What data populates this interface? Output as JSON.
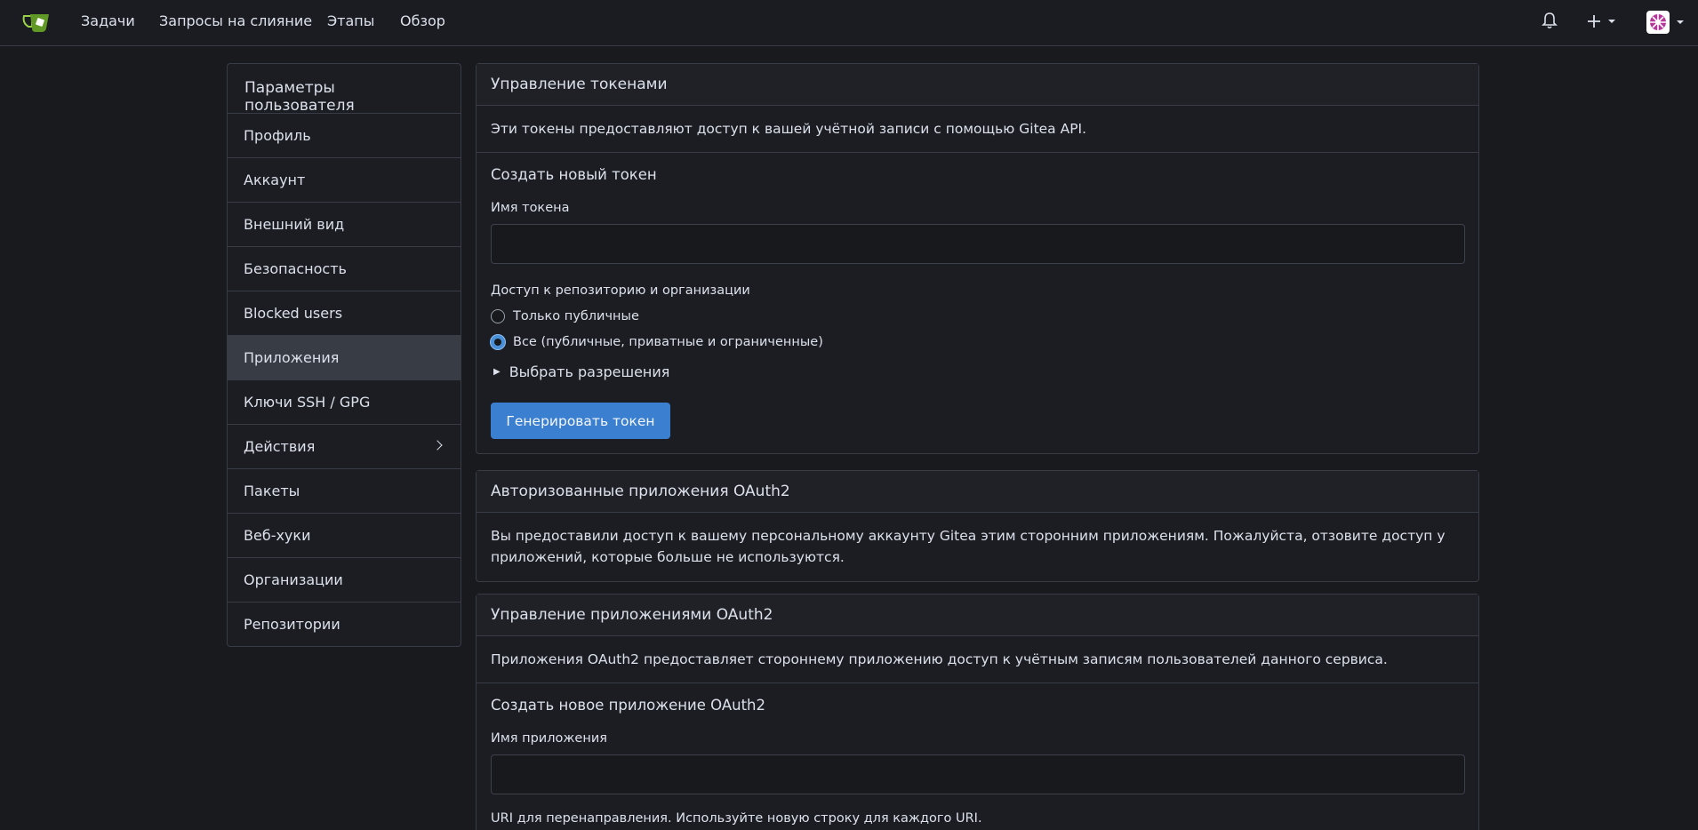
{
  "nav": {
    "logo_icon": "gitea-logo-icon",
    "links": [
      "Задачи",
      "Запросы на слияние",
      "Этапы",
      "Обзор"
    ],
    "right_icons": [
      "bell-icon",
      "plus-icon",
      "avatar"
    ]
  },
  "sidebar": {
    "title": "Параметры пользователя",
    "items": [
      {
        "label": "Профиль"
      },
      {
        "label": "Аккаунт"
      },
      {
        "label": "Внешний вид"
      },
      {
        "label": "Безопасность"
      },
      {
        "label": "Blocked users"
      },
      {
        "label": "Приложения",
        "active": true
      },
      {
        "label": "Ключи SSH / GPG"
      },
      {
        "label": "Действия",
        "has_chevron": true
      },
      {
        "label": "Пакеты"
      },
      {
        "label": "Веб-хуки"
      },
      {
        "label": "Организации"
      },
      {
        "label": "Репозитории"
      }
    ]
  },
  "tokens": {
    "title": "Управление токенами",
    "description": "Эти токены предоставляют доступ к вашей учётной записи с помощью Gitea API.",
    "create_title": "Создать новый токен",
    "name_label": "Имя токена",
    "name_value": "",
    "access_label": "Доступ к репозиторию и организации",
    "radio_public": "Только публичные",
    "radio_all": "Все (публичные, приватные и ограниченные)",
    "selected_radio": "all",
    "permissions_toggle": "Выбрать разрешения",
    "generate_button": "Генерировать токен"
  },
  "authorized": {
    "title": "Авторизованные приложения OAuth2",
    "description": "Вы предоставили доступ к вашему персональному аккаунту Gitea этим сторонним приложениям. Пожалуйста, отзовите доступ у приложений, которые больше не используются."
  },
  "oauth_apps": {
    "title": "Управление приложениями OAuth2",
    "description": "Приложения OAuth2 предоставляет стороннему приложению доступ к учётным записям пользователей данного сервиса.",
    "create_title": "Создать новое приложение OAuth2",
    "name_label": "Имя приложения",
    "name_value": "",
    "redirect_label": "URI для перенаправления. Используйте новую строку для каждого URI."
  },
  "colors": {
    "background": "#181a1e",
    "accent": "#3b7fd0",
    "border": "#383c47",
    "logo_green": "#609926"
  }
}
